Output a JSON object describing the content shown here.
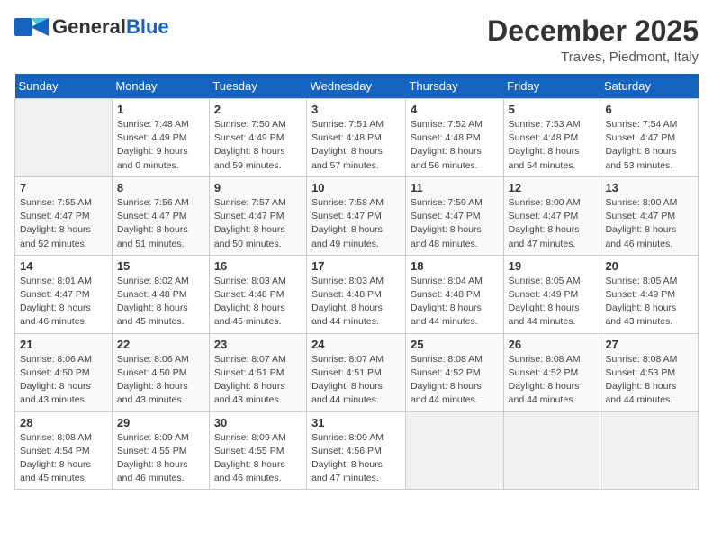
{
  "header": {
    "logo_general": "General",
    "logo_blue": "Blue",
    "month": "December 2025",
    "location": "Traves, Piedmont, Italy"
  },
  "days_of_week": [
    "Sunday",
    "Monday",
    "Tuesday",
    "Wednesday",
    "Thursday",
    "Friday",
    "Saturday"
  ],
  "weeks": [
    [
      {
        "day": "",
        "info": ""
      },
      {
        "day": "1",
        "info": "Sunrise: 7:48 AM\nSunset: 4:49 PM\nDaylight: 9 hours\nand 0 minutes."
      },
      {
        "day": "2",
        "info": "Sunrise: 7:50 AM\nSunset: 4:49 PM\nDaylight: 8 hours\nand 59 minutes."
      },
      {
        "day": "3",
        "info": "Sunrise: 7:51 AM\nSunset: 4:48 PM\nDaylight: 8 hours\nand 57 minutes."
      },
      {
        "day": "4",
        "info": "Sunrise: 7:52 AM\nSunset: 4:48 PM\nDaylight: 8 hours\nand 56 minutes."
      },
      {
        "day": "5",
        "info": "Sunrise: 7:53 AM\nSunset: 4:48 PM\nDaylight: 8 hours\nand 54 minutes."
      },
      {
        "day": "6",
        "info": "Sunrise: 7:54 AM\nSunset: 4:47 PM\nDaylight: 8 hours\nand 53 minutes."
      }
    ],
    [
      {
        "day": "7",
        "info": "Sunrise: 7:55 AM\nSunset: 4:47 PM\nDaylight: 8 hours\nand 52 minutes."
      },
      {
        "day": "8",
        "info": "Sunrise: 7:56 AM\nSunset: 4:47 PM\nDaylight: 8 hours\nand 51 minutes."
      },
      {
        "day": "9",
        "info": "Sunrise: 7:57 AM\nSunset: 4:47 PM\nDaylight: 8 hours\nand 50 minutes."
      },
      {
        "day": "10",
        "info": "Sunrise: 7:58 AM\nSunset: 4:47 PM\nDaylight: 8 hours\nand 49 minutes."
      },
      {
        "day": "11",
        "info": "Sunrise: 7:59 AM\nSunset: 4:47 PM\nDaylight: 8 hours\nand 48 minutes."
      },
      {
        "day": "12",
        "info": "Sunrise: 8:00 AM\nSunset: 4:47 PM\nDaylight: 8 hours\nand 47 minutes."
      },
      {
        "day": "13",
        "info": "Sunrise: 8:00 AM\nSunset: 4:47 PM\nDaylight: 8 hours\nand 46 minutes."
      }
    ],
    [
      {
        "day": "14",
        "info": "Sunrise: 8:01 AM\nSunset: 4:47 PM\nDaylight: 8 hours\nand 46 minutes."
      },
      {
        "day": "15",
        "info": "Sunrise: 8:02 AM\nSunset: 4:48 PM\nDaylight: 8 hours\nand 45 minutes."
      },
      {
        "day": "16",
        "info": "Sunrise: 8:03 AM\nSunset: 4:48 PM\nDaylight: 8 hours\nand 45 minutes."
      },
      {
        "day": "17",
        "info": "Sunrise: 8:03 AM\nSunset: 4:48 PM\nDaylight: 8 hours\nand 44 minutes."
      },
      {
        "day": "18",
        "info": "Sunrise: 8:04 AM\nSunset: 4:48 PM\nDaylight: 8 hours\nand 44 minutes."
      },
      {
        "day": "19",
        "info": "Sunrise: 8:05 AM\nSunset: 4:49 PM\nDaylight: 8 hours\nand 44 minutes."
      },
      {
        "day": "20",
        "info": "Sunrise: 8:05 AM\nSunset: 4:49 PM\nDaylight: 8 hours\nand 43 minutes."
      }
    ],
    [
      {
        "day": "21",
        "info": "Sunrise: 8:06 AM\nSunset: 4:50 PM\nDaylight: 8 hours\nand 43 minutes."
      },
      {
        "day": "22",
        "info": "Sunrise: 8:06 AM\nSunset: 4:50 PM\nDaylight: 8 hours\nand 43 minutes."
      },
      {
        "day": "23",
        "info": "Sunrise: 8:07 AM\nSunset: 4:51 PM\nDaylight: 8 hours\nand 43 minutes."
      },
      {
        "day": "24",
        "info": "Sunrise: 8:07 AM\nSunset: 4:51 PM\nDaylight: 8 hours\nand 44 minutes."
      },
      {
        "day": "25",
        "info": "Sunrise: 8:08 AM\nSunset: 4:52 PM\nDaylight: 8 hours\nand 44 minutes."
      },
      {
        "day": "26",
        "info": "Sunrise: 8:08 AM\nSunset: 4:52 PM\nDaylight: 8 hours\nand 44 minutes."
      },
      {
        "day": "27",
        "info": "Sunrise: 8:08 AM\nSunset: 4:53 PM\nDaylight: 8 hours\nand 44 minutes."
      }
    ],
    [
      {
        "day": "28",
        "info": "Sunrise: 8:08 AM\nSunset: 4:54 PM\nDaylight: 8 hours\nand 45 minutes."
      },
      {
        "day": "29",
        "info": "Sunrise: 8:09 AM\nSunset: 4:55 PM\nDaylight: 8 hours\nand 46 minutes."
      },
      {
        "day": "30",
        "info": "Sunrise: 8:09 AM\nSunset: 4:55 PM\nDaylight: 8 hours\nand 46 minutes."
      },
      {
        "day": "31",
        "info": "Sunrise: 8:09 AM\nSunset: 4:56 PM\nDaylight: 8 hours\nand 47 minutes."
      },
      {
        "day": "",
        "info": ""
      },
      {
        "day": "",
        "info": ""
      },
      {
        "day": "",
        "info": ""
      }
    ]
  ]
}
